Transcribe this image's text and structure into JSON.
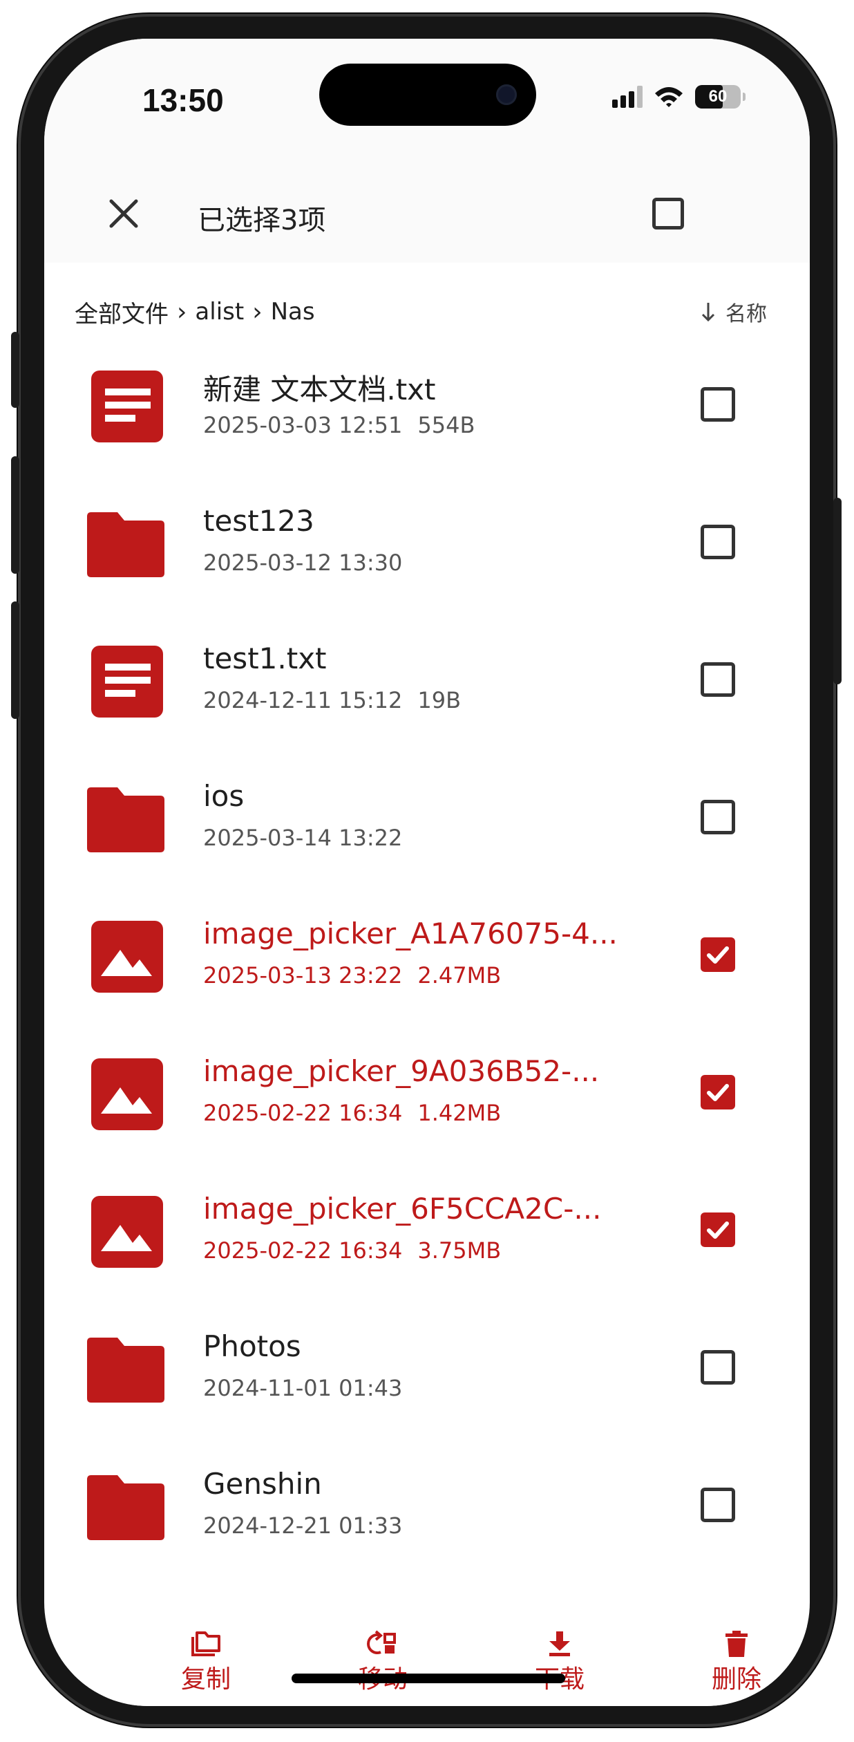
{
  "status_bar": {
    "time": "13:50",
    "battery": "60",
    "battery_fraction": 0.6
  },
  "header": {
    "title": "已选择3项"
  },
  "breadcrumb": {
    "items": [
      "全部文件",
      "alist",
      "Nas"
    ]
  },
  "sort": {
    "label": "名称"
  },
  "files": [
    {
      "name": "新建 文本文档.txt",
      "date": "2025-03-03 12:51",
      "size": "554B",
      "type": "document",
      "selected": false
    },
    {
      "name": "test123",
      "date": "2025-03-12 13:30",
      "size": "",
      "type": "folder",
      "selected": false
    },
    {
      "name": "test1.txt",
      "date": "2024-12-11 15:12",
      "size": "19B",
      "type": "document",
      "selected": false
    },
    {
      "name": "ios",
      "date": "2025-03-14 13:22",
      "size": "",
      "type": "folder",
      "selected": false
    },
    {
      "name": "image_picker_A1A76075-4...",
      "date": "2025-03-13 23:22",
      "size": "2.47MB",
      "type": "image",
      "selected": true
    },
    {
      "name": "image_picker_9A036B52-...",
      "date": "2025-02-22 16:34",
      "size": "1.42MB",
      "type": "image",
      "selected": true
    },
    {
      "name": "image_picker_6F5CCA2C-...",
      "date": "2025-02-22 16:34",
      "size": "3.75MB",
      "type": "image",
      "selected": true
    },
    {
      "name": "Photos",
      "date": "2024-11-01 01:43",
      "size": "",
      "type": "folder",
      "selected": false
    },
    {
      "name": "Genshin",
      "date": "2024-12-21 01:33",
      "size": "",
      "type": "folder",
      "selected": false
    }
  ],
  "actions": {
    "copy": "复制",
    "move": "移动",
    "download": "下载",
    "delete": "删除"
  },
  "colors": {
    "accent": "#be1a1a",
    "text": "#1f1f1f",
    "secondary": "#555555"
  }
}
